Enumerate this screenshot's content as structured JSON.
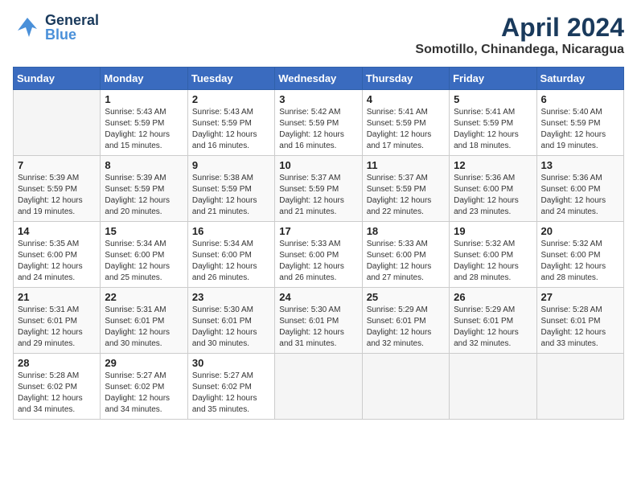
{
  "header": {
    "logo_general": "General",
    "logo_blue": "Blue",
    "title": "April 2024",
    "subtitle": "Somotillo, Chinandega, Nicaragua"
  },
  "columns": [
    "Sunday",
    "Monday",
    "Tuesday",
    "Wednesday",
    "Thursday",
    "Friday",
    "Saturday"
  ],
  "weeks": [
    [
      {
        "day": "",
        "info": ""
      },
      {
        "day": "1",
        "info": "Sunrise: 5:43 AM\nSunset: 5:59 PM\nDaylight: 12 hours\nand 15 minutes."
      },
      {
        "day": "2",
        "info": "Sunrise: 5:43 AM\nSunset: 5:59 PM\nDaylight: 12 hours\nand 16 minutes."
      },
      {
        "day": "3",
        "info": "Sunrise: 5:42 AM\nSunset: 5:59 PM\nDaylight: 12 hours\nand 16 minutes."
      },
      {
        "day": "4",
        "info": "Sunrise: 5:41 AM\nSunset: 5:59 PM\nDaylight: 12 hours\nand 17 minutes."
      },
      {
        "day": "5",
        "info": "Sunrise: 5:41 AM\nSunset: 5:59 PM\nDaylight: 12 hours\nand 18 minutes."
      },
      {
        "day": "6",
        "info": "Sunrise: 5:40 AM\nSunset: 5:59 PM\nDaylight: 12 hours\nand 19 minutes."
      }
    ],
    [
      {
        "day": "7",
        "info": "Sunrise: 5:39 AM\nSunset: 5:59 PM\nDaylight: 12 hours\nand 19 minutes."
      },
      {
        "day": "8",
        "info": "Sunrise: 5:39 AM\nSunset: 5:59 PM\nDaylight: 12 hours\nand 20 minutes."
      },
      {
        "day": "9",
        "info": "Sunrise: 5:38 AM\nSunset: 5:59 PM\nDaylight: 12 hours\nand 21 minutes."
      },
      {
        "day": "10",
        "info": "Sunrise: 5:37 AM\nSunset: 5:59 PM\nDaylight: 12 hours\nand 21 minutes."
      },
      {
        "day": "11",
        "info": "Sunrise: 5:37 AM\nSunset: 5:59 PM\nDaylight: 12 hours\nand 22 minutes."
      },
      {
        "day": "12",
        "info": "Sunrise: 5:36 AM\nSunset: 6:00 PM\nDaylight: 12 hours\nand 23 minutes."
      },
      {
        "day": "13",
        "info": "Sunrise: 5:36 AM\nSunset: 6:00 PM\nDaylight: 12 hours\nand 24 minutes."
      }
    ],
    [
      {
        "day": "14",
        "info": "Sunrise: 5:35 AM\nSunset: 6:00 PM\nDaylight: 12 hours\nand 24 minutes."
      },
      {
        "day": "15",
        "info": "Sunrise: 5:34 AM\nSunset: 6:00 PM\nDaylight: 12 hours\nand 25 minutes."
      },
      {
        "day": "16",
        "info": "Sunrise: 5:34 AM\nSunset: 6:00 PM\nDaylight: 12 hours\nand 26 minutes."
      },
      {
        "day": "17",
        "info": "Sunrise: 5:33 AM\nSunset: 6:00 PM\nDaylight: 12 hours\nand 26 minutes."
      },
      {
        "day": "18",
        "info": "Sunrise: 5:33 AM\nSunset: 6:00 PM\nDaylight: 12 hours\nand 27 minutes."
      },
      {
        "day": "19",
        "info": "Sunrise: 5:32 AM\nSunset: 6:00 PM\nDaylight: 12 hours\nand 28 minutes."
      },
      {
        "day": "20",
        "info": "Sunrise: 5:32 AM\nSunset: 6:00 PM\nDaylight: 12 hours\nand 28 minutes."
      }
    ],
    [
      {
        "day": "21",
        "info": "Sunrise: 5:31 AM\nSunset: 6:01 PM\nDaylight: 12 hours\nand 29 minutes."
      },
      {
        "day": "22",
        "info": "Sunrise: 5:31 AM\nSunset: 6:01 PM\nDaylight: 12 hours\nand 30 minutes."
      },
      {
        "day": "23",
        "info": "Sunrise: 5:30 AM\nSunset: 6:01 PM\nDaylight: 12 hours\nand 30 minutes."
      },
      {
        "day": "24",
        "info": "Sunrise: 5:30 AM\nSunset: 6:01 PM\nDaylight: 12 hours\nand 31 minutes."
      },
      {
        "day": "25",
        "info": "Sunrise: 5:29 AM\nSunset: 6:01 PM\nDaylight: 12 hours\nand 32 minutes."
      },
      {
        "day": "26",
        "info": "Sunrise: 5:29 AM\nSunset: 6:01 PM\nDaylight: 12 hours\nand 32 minutes."
      },
      {
        "day": "27",
        "info": "Sunrise: 5:28 AM\nSunset: 6:01 PM\nDaylight: 12 hours\nand 33 minutes."
      }
    ],
    [
      {
        "day": "28",
        "info": "Sunrise: 5:28 AM\nSunset: 6:02 PM\nDaylight: 12 hours\nand 34 minutes."
      },
      {
        "day": "29",
        "info": "Sunrise: 5:27 AM\nSunset: 6:02 PM\nDaylight: 12 hours\nand 34 minutes."
      },
      {
        "day": "30",
        "info": "Sunrise: 5:27 AM\nSunset: 6:02 PM\nDaylight: 12 hours\nand 35 minutes."
      },
      {
        "day": "",
        "info": ""
      },
      {
        "day": "",
        "info": ""
      },
      {
        "day": "",
        "info": ""
      },
      {
        "day": "",
        "info": ""
      }
    ]
  ]
}
